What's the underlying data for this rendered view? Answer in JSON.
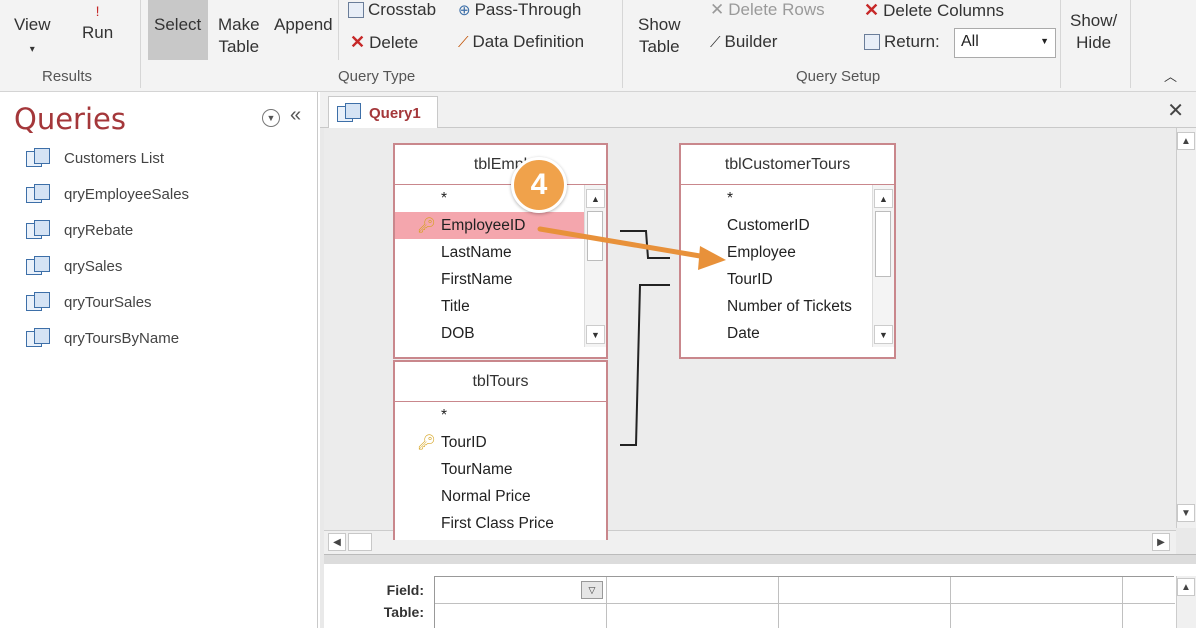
{
  "ribbon": {
    "results": {
      "view_label": "View",
      "run_label": "Run",
      "group_label": "Results"
    },
    "query_type": {
      "select_label": "Select",
      "make_table_label": "Make\nTable",
      "append_label": "Append",
      "crosstab_label": "Crosstab",
      "delete_label": "Delete",
      "pass_through_label": "Pass-Through",
      "data_definition_label": "Data Definition",
      "group_label": "Query Type"
    },
    "query_setup": {
      "show_table_label": "Show\nTable",
      "delete_rows_label": "Delete Rows",
      "builder_label": "Builder",
      "delete_columns_label": "Delete Columns",
      "return_label": "Return:",
      "return_value": "All",
      "group_label": "Query Setup"
    },
    "show_hide_label": "Show/\nHide"
  },
  "nav": {
    "title": "Queries",
    "items": [
      {
        "label": "Customers List"
      },
      {
        "label": "qryEmployeeSales"
      },
      {
        "label": "qryRebate"
      },
      {
        "label": "qrySales"
      },
      {
        "label": "qryTourSales"
      },
      {
        "label": "qryToursByName"
      }
    ]
  },
  "document": {
    "tab_label": "Query1",
    "tables": {
      "employees": {
        "title": "tblEmpl",
        "fields": [
          "*",
          "EmployeeID",
          "LastName",
          "FirstName",
          "Title",
          "DOB"
        ],
        "key_field": "EmployeeID",
        "selected_field": "EmployeeID"
      },
      "tours": {
        "title": "tblTours",
        "fields": [
          "*",
          "TourID",
          "TourName",
          "Normal Price",
          "First Class Price"
        ],
        "key_field": "TourID"
      },
      "customer_tours": {
        "title": "tblCustomerTours",
        "fields": [
          "*",
          "CustomerID",
          "Employee",
          "TourID",
          "Number of Tickets",
          "Date"
        ]
      }
    },
    "step_callout": "4"
  },
  "qbe": {
    "row_labels": [
      "Field:",
      "Table:"
    ]
  },
  "colors": {
    "accent": "#a4373a",
    "table_border": "#c9878c",
    "selected_field": "#f4a6ad",
    "callout": "#f0a24b",
    "drag_arrow": "#e8913a"
  }
}
